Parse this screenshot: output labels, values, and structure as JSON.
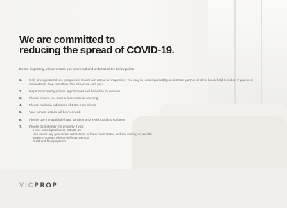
{
  "headline": {
    "line1": "We are committed to",
    "line2": "reducing the spread of COVID-19."
  },
  "intro": "Before inspecting, please ensure you have read and understood the below points:",
  "points": [
    {
      "num": "1.",
      "text": "Only one agent and one prospective tenant can attend an inspection. You may be accompanied by an intimate partner or other household member. If you need dependants, they can attend the inspection with you.",
      "subs": []
    },
    {
      "num": "2.",
      "text": "Inspections are by private appointment and limited to 15 minutes",
      "subs": []
    },
    {
      "num": "3.",
      "text": "Please ensure you wear a face mask or covering.",
      "subs": []
    },
    {
      "num": "4.",
      "text": "Please maintain a distance of 1.5m from others.",
      "subs": []
    },
    {
      "num": "5.",
      "text": "Your contact details will be recorded.",
      "subs": []
    },
    {
      "num": "6.",
      "text": "Please use the available hand sanitiser and avoid touching surfaces.",
      "subs": []
    },
    {
      "num": "7.",
      "text": "Please do not enter the property if you:",
      "subs": [
        "Have tested positive to COVID-19",
        "Are under any quarantine restrictions or have been tested and are waiting on results",
        "Been in contact with an infected person",
        "Cold and flu symptoms"
      ]
    }
  ],
  "logo": {
    "part1": "VIC",
    "part2": "PROP"
  }
}
